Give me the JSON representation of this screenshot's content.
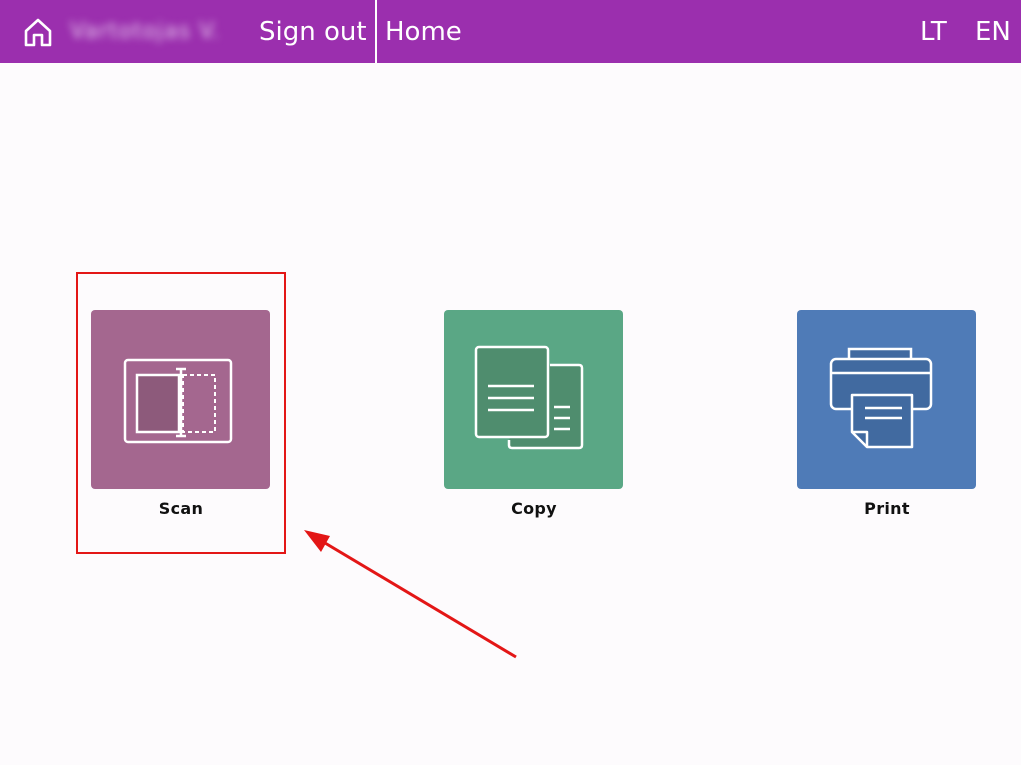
{
  "header": {
    "user_name": "Vartotojas V.",
    "sign_out_label": "Sign out",
    "page_title": "Home",
    "languages": [
      "LT",
      "EN"
    ],
    "background_color": "#9b2fae"
  },
  "tiles": [
    {
      "label": "Scan",
      "icon": "scan-icon",
      "color": "#a4678f"
    },
    {
      "label": "Copy",
      "icon": "copy-icon",
      "color": "#5aa785"
    },
    {
      "label": "Print",
      "icon": "printer-icon",
      "color": "#4f7bb7"
    }
  ],
  "annotation": {
    "highlight_color": "#e31616",
    "highlighted_tile": "Scan"
  }
}
